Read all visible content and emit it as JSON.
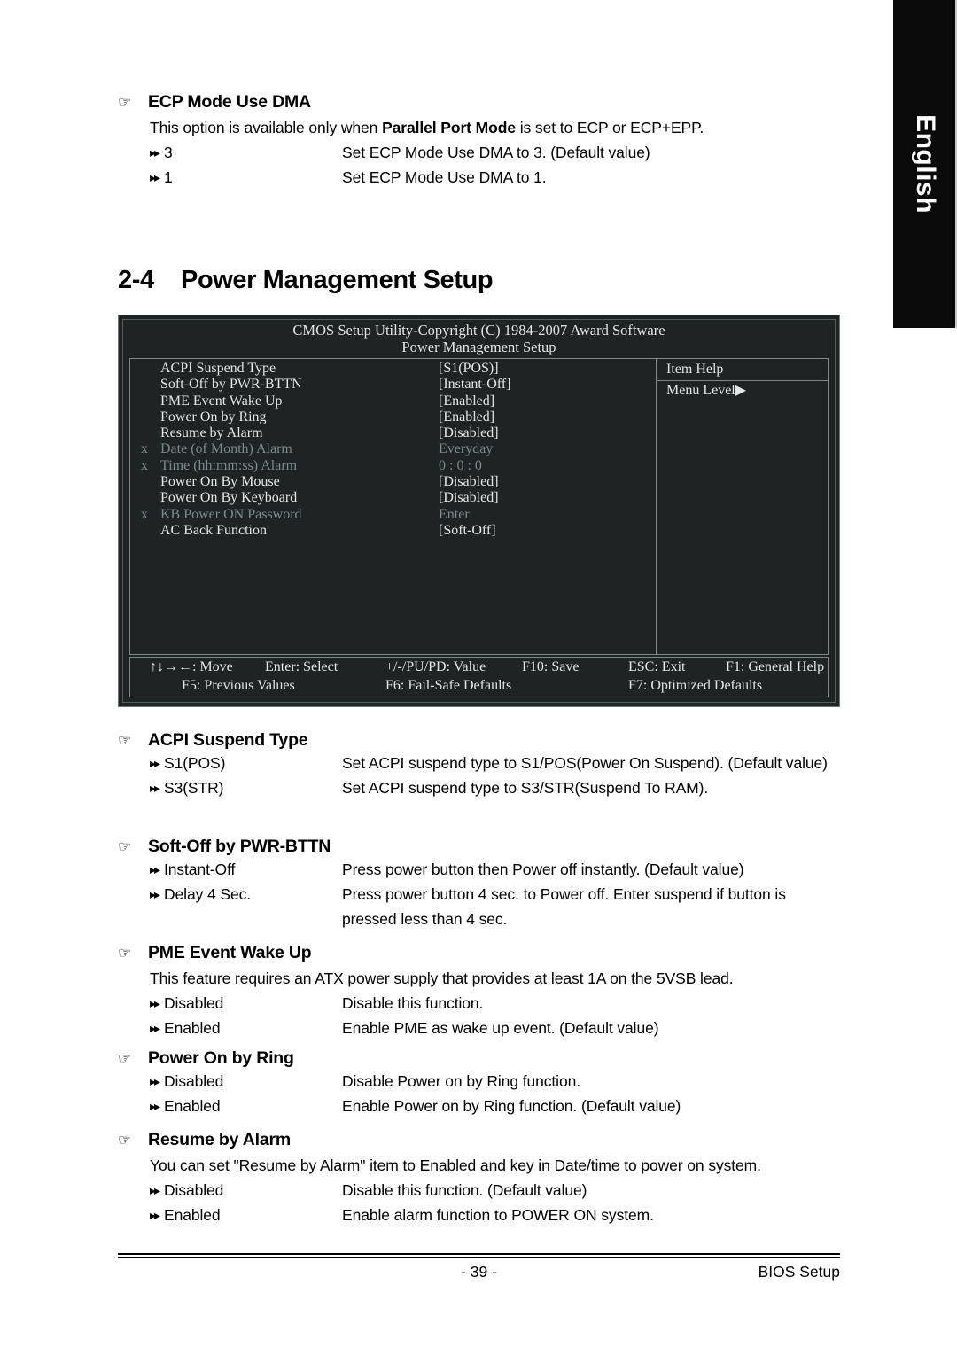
{
  "language_tab": {
    "label": "English"
  },
  "top_section": {
    "heading": "ECP Mode Use DMA",
    "hand_icon": "☞",
    "intro_pre": "This option is available only when ",
    "intro_bold": "Parallel Port Mode",
    "intro_post": " is set to ECP or ECP+EPP.",
    "options": [
      {
        "bullet": "▸▸",
        "name": "3",
        "desc": "Set ECP Mode Use DMA to 3. (Default value)"
      },
      {
        "bullet": "▸▸",
        "name": "1",
        "desc": "Set ECP Mode Use DMA to 1."
      }
    ]
  },
  "chapter": {
    "number": "2-4",
    "title": "Power Management Setup"
  },
  "bios": {
    "title": "CMOS Setup Utility-Copyright (C) 1984-2007 Award Software",
    "subtitle": "Power Management Setup",
    "help_title": "Item Help",
    "help_line": "Menu Level▶",
    "items": [
      {
        "mark": "",
        "label": "ACPI Suspend Type",
        "value": "[S1(POS)]",
        "dim": false
      },
      {
        "mark": "",
        "label": "Soft-Off by PWR-BTTN",
        "value": "[Instant-Off]",
        "dim": false
      },
      {
        "mark": "",
        "label": "PME Event Wake Up",
        "value": "[Enabled]",
        "dim": false
      },
      {
        "mark": "",
        "label": "Power On by Ring",
        "value": "[Enabled]",
        "dim": false
      },
      {
        "mark": "",
        "label": "Resume by Alarm",
        "value": "[Disabled]",
        "dim": false
      },
      {
        "mark": "x",
        "label": "Date (of Month) Alarm",
        "value": "Everyday",
        "dim": true
      },
      {
        "mark": "x",
        "label": "Time (hh:mm:ss) Alarm",
        "value": "0 : 0 : 0",
        "dim": true
      },
      {
        "mark": "",
        "label": "Power On By Mouse",
        "value": "[Disabled]",
        "dim": false
      },
      {
        "mark": "",
        "label": "Power On By Keyboard",
        "value": "[Disabled]",
        "dim": false
      },
      {
        "mark": "x",
        "label": "KB Power ON Password",
        "value": "Enter",
        "dim": true
      },
      {
        "mark": "",
        "label": "AC Back Function",
        "value": "[Soft-Off]",
        "dim": false
      }
    ],
    "footer": {
      "move": "↑↓→←: Move",
      "enter": "Enter: Select",
      "value": "+/-/PU/PD: Value",
      "save": "F10: Save",
      "exit": "ESC: Exit",
      "help": "F1: General Help",
      "f5": "F5: Previous Values",
      "f6": "F6: Fail-Safe Defaults",
      "f7": "F7: Optimized Defaults"
    }
  },
  "sections": [
    {
      "heading": "ACPI Suspend Type",
      "hand_icon": "☞",
      "note": null,
      "options": [
        {
          "bullet": "▸▸",
          "name": "S1(POS)",
          "desc": "Set ACPI suspend type to S1/POS(Power On Suspend). (Default value)"
        },
        {
          "bullet": "▸▸",
          "name": "S3(STR)",
          "desc": "Set ACPI suspend type to S3/STR(Suspend To RAM)."
        }
      ]
    },
    {
      "heading": "Soft-Off by PWR-BTTN",
      "hand_icon": "☞",
      "note": null,
      "options": [
        {
          "bullet": "▸▸",
          "name": "Instant-Off",
          "desc": "Press power button then Power off instantly. (Default value)"
        },
        {
          "bullet": "▸▸",
          "name": "Delay 4 Sec.",
          "desc": "Press power button 4 sec. to Power off. Enter suspend if button is pressed less than 4 sec."
        }
      ]
    },
    {
      "heading": "PME Event Wake Up",
      "hand_icon": "☞",
      "note": "This feature requires an ATX power supply that provides at least 1A on the 5VSB lead.",
      "options": [
        {
          "bullet": "▸▸",
          "name": "Disabled",
          "desc": "Disable this function."
        },
        {
          "bullet": "▸▸",
          "name": "Enabled",
          "desc": "Enable PME as wake up event. (Default value)"
        }
      ]
    },
    {
      "heading": "Power On by Ring",
      "hand_icon": "☞",
      "note": null,
      "options": [
        {
          "bullet": "▸▸",
          "name": "Disabled",
          "desc": "Disable Power on by Ring function."
        },
        {
          "bullet": "▸▸",
          "name": "Enabled",
          "desc": "Enable Power on by Ring function. (Default value)"
        }
      ]
    },
    {
      "heading": "Resume by Alarm",
      "hand_icon": "☞",
      "note": "You can set \"Resume by Alarm\" item to Enabled and key in Date/time to power on system.",
      "options": [
        {
          "bullet": "▸▸",
          "name": "Disabled",
          "desc": "Disable this function. (Default value)"
        },
        {
          "bullet": "▸▸",
          "name": "Enabled",
          "desc": "Enable alarm function to POWER ON system."
        }
      ]
    }
  ],
  "page_footer": {
    "page_number": "- 39 -",
    "section_label": "BIOS Setup"
  }
}
